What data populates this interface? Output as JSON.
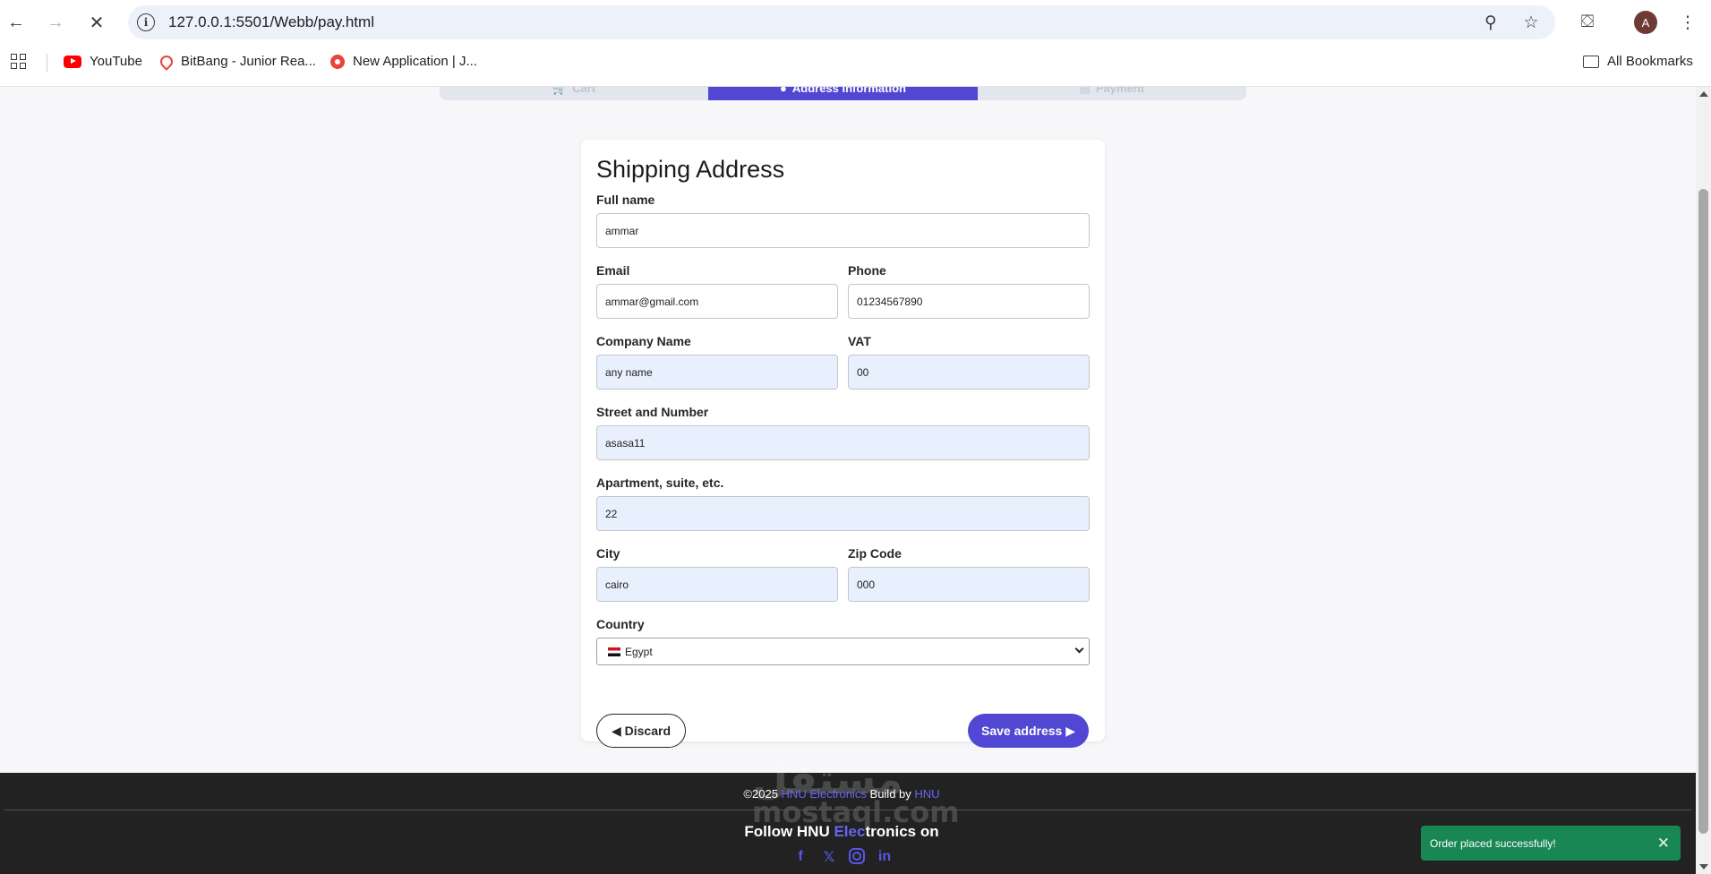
{
  "browser": {
    "url": "127.0.0.1:5501/Webb/pay.html",
    "avatar_letter": "A",
    "bookmarks": [
      {
        "label": "YouTube",
        "icon": "youtube-icon"
      },
      {
        "label": "BitBang - Junior Rea...",
        "icon": "map-pin-icon"
      },
      {
        "label": "New Application | J...",
        "icon": "app-icon"
      }
    ],
    "all_bookmarks_label": "All Bookmarks"
  },
  "steps": [
    {
      "label": "Cart",
      "icon": "cart-icon"
    },
    {
      "label": "Address Information",
      "icon": "pin-icon"
    },
    {
      "label": "Payment",
      "icon": "card-icon"
    }
  ],
  "form": {
    "title": "Shipping Address",
    "full_name": {
      "label": "Full name",
      "value": "ammar"
    },
    "email": {
      "label": "Email",
      "value": "ammar@gmail.com"
    },
    "phone": {
      "label": "Phone",
      "value": "01234567890"
    },
    "company": {
      "label": "Company Name",
      "value": "any name"
    },
    "vat": {
      "label": "VAT",
      "value": "00"
    },
    "street": {
      "label": "Street and Number",
      "value": "asasa11"
    },
    "apartment": {
      "label": "Apartment, suite, etc.",
      "value": "22"
    },
    "city": {
      "label": "City",
      "value": "cairo"
    },
    "zip": {
      "label": "Zip Code",
      "value": "000"
    },
    "country": {
      "label": "Country",
      "value": "Egypt"
    },
    "discard_label": "◀ Discard",
    "save_label": "Save address ▶"
  },
  "footer": {
    "copy_prefix": "©2025 ",
    "brand": "HNU Electronics",
    "build_by": " Build by ",
    "builder": "HNU",
    "follow_prefix": "Follow HNU ",
    "follow_link": "Elec",
    "follow_suffix": "tronics on",
    "watermark_ar": "مستقل",
    "watermark_en": "mostaql.com"
  },
  "toast": {
    "message": "Order placed successfully!"
  },
  "colors": {
    "accent": "#5147d3",
    "success": "#198754",
    "footer_bg": "#222222"
  }
}
